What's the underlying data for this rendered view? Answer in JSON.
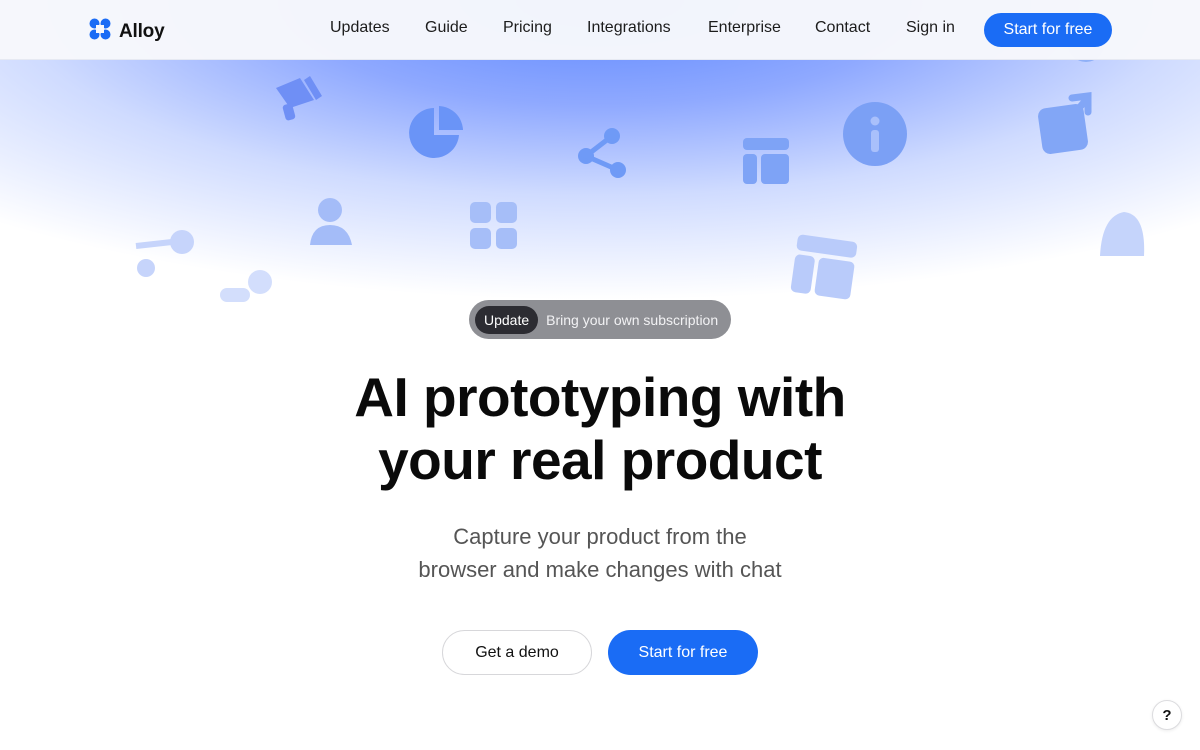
{
  "brand": {
    "name": "Alloy",
    "logo_icon": "alloy-logo-icon",
    "color": "#1a6cf5"
  },
  "nav": {
    "links": [
      "Updates",
      "Guide",
      "Pricing",
      "Integrations",
      "Enterprise",
      "Contact",
      "Sign in"
    ],
    "cta": "Start for free"
  },
  "hero": {
    "badge_tag": "Update",
    "badge_text": "Bring your own subscription",
    "headline_line1": "AI prototyping with",
    "headline_line2": "your real product",
    "subhead_line1": "Capture your product from the",
    "subhead_line2": "browser and make changes with chat",
    "secondary_cta": "Get a demo",
    "primary_cta": "Start for free"
  },
  "help": {
    "label": "?"
  },
  "background_icons": [
    "megaphone-icon",
    "pie-chart-icon",
    "share-icon",
    "layout-icon",
    "info-icon",
    "external-link-icon",
    "user-icon",
    "grid-icon",
    "table-icon",
    "bell-icon",
    "connector-icon"
  ],
  "colors": {
    "accent": "#1a6cf5",
    "hero_gradient": "#5a85ff"
  }
}
